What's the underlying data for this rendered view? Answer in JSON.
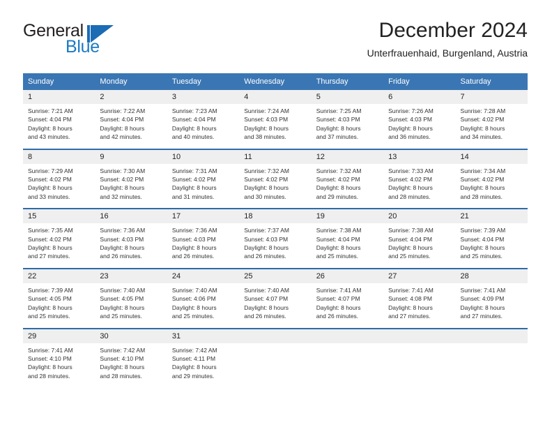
{
  "brand": {
    "name_part1": "General",
    "name_part2": "Blue",
    "mark": "triangle-logo",
    "color_dark": "#231f20",
    "color_blue": "#1b7ac4"
  },
  "header": {
    "title": "December 2024",
    "subtitle": "Unterfrauenhaid, Burgenland, Austria"
  },
  "theme": {
    "header_bg": "#3b76b4",
    "header_text": "#ffffff",
    "row_divider": "#2d6ca8",
    "daynum_bg": "#efefef",
    "body_text": "#333333"
  },
  "calendar": {
    "weekday_headers": [
      "Sunday",
      "Monday",
      "Tuesday",
      "Wednesday",
      "Thursday",
      "Friday",
      "Saturday"
    ],
    "weeks": [
      [
        {
          "day": "1",
          "sunrise": "Sunrise: 7:21 AM",
          "sunset": "Sunset: 4:04 PM",
          "daylight_line1": "Daylight: 8 hours",
          "daylight_line2": "and 43 minutes."
        },
        {
          "day": "2",
          "sunrise": "Sunrise: 7:22 AM",
          "sunset": "Sunset: 4:04 PM",
          "daylight_line1": "Daylight: 8 hours",
          "daylight_line2": "and 42 minutes."
        },
        {
          "day": "3",
          "sunrise": "Sunrise: 7:23 AM",
          "sunset": "Sunset: 4:04 PM",
          "daylight_line1": "Daylight: 8 hours",
          "daylight_line2": "and 40 minutes."
        },
        {
          "day": "4",
          "sunrise": "Sunrise: 7:24 AM",
          "sunset": "Sunset: 4:03 PM",
          "daylight_line1": "Daylight: 8 hours",
          "daylight_line2": "and 38 minutes."
        },
        {
          "day": "5",
          "sunrise": "Sunrise: 7:25 AM",
          "sunset": "Sunset: 4:03 PM",
          "daylight_line1": "Daylight: 8 hours",
          "daylight_line2": "and 37 minutes."
        },
        {
          "day": "6",
          "sunrise": "Sunrise: 7:26 AM",
          "sunset": "Sunset: 4:03 PM",
          "daylight_line1": "Daylight: 8 hours",
          "daylight_line2": "and 36 minutes."
        },
        {
          "day": "7",
          "sunrise": "Sunrise: 7:28 AM",
          "sunset": "Sunset: 4:02 PM",
          "daylight_line1": "Daylight: 8 hours",
          "daylight_line2": "and 34 minutes."
        }
      ],
      [
        {
          "day": "8",
          "sunrise": "Sunrise: 7:29 AM",
          "sunset": "Sunset: 4:02 PM",
          "daylight_line1": "Daylight: 8 hours",
          "daylight_line2": "and 33 minutes."
        },
        {
          "day": "9",
          "sunrise": "Sunrise: 7:30 AM",
          "sunset": "Sunset: 4:02 PM",
          "daylight_line1": "Daylight: 8 hours",
          "daylight_line2": "and 32 minutes."
        },
        {
          "day": "10",
          "sunrise": "Sunrise: 7:31 AM",
          "sunset": "Sunset: 4:02 PM",
          "daylight_line1": "Daylight: 8 hours",
          "daylight_line2": "and 31 minutes."
        },
        {
          "day": "11",
          "sunrise": "Sunrise: 7:32 AM",
          "sunset": "Sunset: 4:02 PM",
          "daylight_line1": "Daylight: 8 hours",
          "daylight_line2": "and 30 minutes."
        },
        {
          "day": "12",
          "sunrise": "Sunrise: 7:32 AM",
          "sunset": "Sunset: 4:02 PM",
          "daylight_line1": "Daylight: 8 hours",
          "daylight_line2": "and 29 minutes."
        },
        {
          "day": "13",
          "sunrise": "Sunrise: 7:33 AM",
          "sunset": "Sunset: 4:02 PM",
          "daylight_line1": "Daylight: 8 hours",
          "daylight_line2": "and 28 minutes."
        },
        {
          "day": "14",
          "sunrise": "Sunrise: 7:34 AM",
          "sunset": "Sunset: 4:02 PM",
          "daylight_line1": "Daylight: 8 hours",
          "daylight_line2": "and 28 minutes."
        }
      ],
      [
        {
          "day": "15",
          "sunrise": "Sunrise: 7:35 AM",
          "sunset": "Sunset: 4:02 PM",
          "daylight_line1": "Daylight: 8 hours",
          "daylight_line2": "and 27 minutes."
        },
        {
          "day": "16",
          "sunrise": "Sunrise: 7:36 AM",
          "sunset": "Sunset: 4:03 PM",
          "daylight_line1": "Daylight: 8 hours",
          "daylight_line2": "and 26 minutes."
        },
        {
          "day": "17",
          "sunrise": "Sunrise: 7:36 AM",
          "sunset": "Sunset: 4:03 PM",
          "daylight_line1": "Daylight: 8 hours",
          "daylight_line2": "and 26 minutes."
        },
        {
          "day": "18",
          "sunrise": "Sunrise: 7:37 AM",
          "sunset": "Sunset: 4:03 PM",
          "daylight_line1": "Daylight: 8 hours",
          "daylight_line2": "and 26 minutes."
        },
        {
          "day": "19",
          "sunrise": "Sunrise: 7:38 AM",
          "sunset": "Sunset: 4:04 PM",
          "daylight_line1": "Daylight: 8 hours",
          "daylight_line2": "and 25 minutes."
        },
        {
          "day": "20",
          "sunrise": "Sunrise: 7:38 AM",
          "sunset": "Sunset: 4:04 PM",
          "daylight_line1": "Daylight: 8 hours",
          "daylight_line2": "and 25 minutes."
        },
        {
          "day": "21",
          "sunrise": "Sunrise: 7:39 AM",
          "sunset": "Sunset: 4:04 PM",
          "daylight_line1": "Daylight: 8 hours",
          "daylight_line2": "and 25 minutes."
        }
      ],
      [
        {
          "day": "22",
          "sunrise": "Sunrise: 7:39 AM",
          "sunset": "Sunset: 4:05 PM",
          "daylight_line1": "Daylight: 8 hours",
          "daylight_line2": "and 25 minutes."
        },
        {
          "day": "23",
          "sunrise": "Sunrise: 7:40 AM",
          "sunset": "Sunset: 4:05 PM",
          "daylight_line1": "Daylight: 8 hours",
          "daylight_line2": "and 25 minutes."
        },
        {
          "day": "24",
          "sunrise": "Sunrise: 7:40 AM",
          "sunset": "Sunset: 4:06 PM",
          "daylight_line1": "Daylight: 8 hours",
          "daylight_line2": "and 25 minutes."
        },
        {
          "day": "25",
          "sunrise": "Sunrise: 7:40 AM",
          "sunset": "Sunset: 4:07 PM",
          "daylight_line1": "Daylight: 8 hours",
          "daylight_line2": "and 26 minutes."
        },
        {
          "day": "26",
          "sunrise": "Sunrise: 7:41 AM",
          "sunset": "Sunset: 4:07 PM",
          "daylight_line1": "Daylight: 8 hours",
          "daylight_line2": "and 26 minutes."
        },
        {
          "day": "27",
          "sunrise": "Sunrise: 7:41 AM",
          "sunset": "Sunset: 4:08 PM",
          "daylight_line1": "Daylight: 8 hours",
          "daylight_line2": "and 27 minutes."
        },
        {
          "day": "28",
          "sunrise": "Sunrise: 7:41 AM",
          "sunset": "Sunset: 4:09 PM",
          "daylight_line1": "Daylight: 8 hours",
          "daylight_line2": "and 27 minutes."
        }
      ],
      [
        {
          "day": "29",
          "sunrise": "Sunrise: 7:41 AM",
          "sunset": "Sunset: 4:10 PM",
          "daylight_line1": "Daylight: 8 hours",
          "daylight_line2": "and 28 minutes."
        },
        {
          "day": "30",
          "sunrise": "Sunrise: 7:42 AM",
          "sunset": "Sunset: 4:10 PM",
          "daylight_line1": "Daylight: 8 hours",
          "daylight_line2": "and 28 minutes."
        },
        {
          "day": "31",
          "sunrise": "Sunrise: 7:42 AM",
          "sunset": "Sunset: 4:11 PM",
          "daylight_line1": "Daylight: 8 hours",
          "daylight_line2": "and 29 minutes."
        },
        {
          "day": "",
          "sunrise": "",
          "sunset": "",
          "daylight_line1": "",
          "daylight_line2": ""
        },
        {
          "day": "",
          "sunrise": "",
          "sunset": "",
          "daylight_line1": "",
          "daylight_line2": ""
        },
        {
          "day": "",
          "sunrise": "",
          "sunset": "",
          "daylight_line1": "",
          "daylight_line2": ""
        },
        {
          "day": "",
          "sunrise": "",
          "sunset": "",
          "daylight_line1": "",
          "daylight_line2": ""
        }
      ]
    ]
  }
}
